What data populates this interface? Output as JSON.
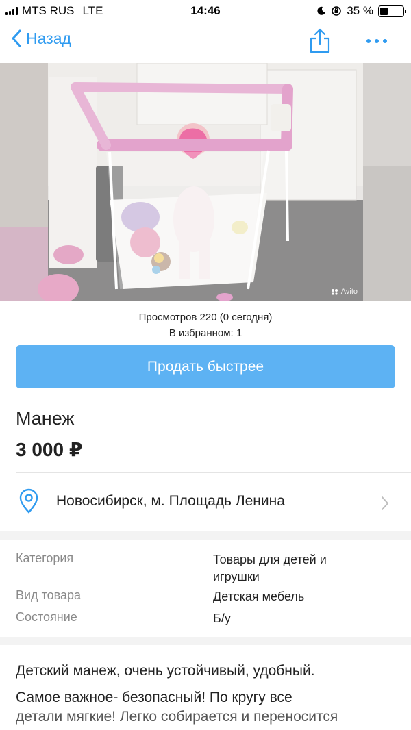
{
  "status_bar": {
    "carrier": "MTS RUS",
    "network": "LTE",
    "time": "14:46",
    "battery_percent": "35 %",
    "battery_level": 0.35
  },
  "nav": {
    "back_label": "Назад",
    "share_icon": "share-icon",
    "more_icon": "more-icon"
  },
  "photo": {
    "watermark": "Avito"
  },
  "stats": {
    "views": "Просмотров 220 (0 сегодня)",
    "favorites": "В избранном: 1"
  },
  "actions": {
    "sell_faster_label": "Продать быстрее",
    "sell_faster_color": "#5db2f3"
  },
  "listing": {
    "title": "Манеж",
    "price": "3 000 ₽",
    "location": "Новосибирск, м. Площадь Ленина"
  },
  "params": [
    {
      "label": "Категория",
      "value": "Товары для детей и игрушки"
    },
    {
      "label": "Вид товара",
      "value": "Детская мебель"
    },
    {
      "label": "Состояние",
      "value": "Б/у"
    }
  ],
  "description": {
    "line1": "Детский манеж, очень устойчивый, удобный.",
    "line2": "Самое важное- безопасный! По кругу все",
    "line3": "детали мягкие! Легко собирается и переносится"
  },
  "colors": {
    "accent": "#2f9bf0",
    "pink": "#e8a7cf"
  }
}
